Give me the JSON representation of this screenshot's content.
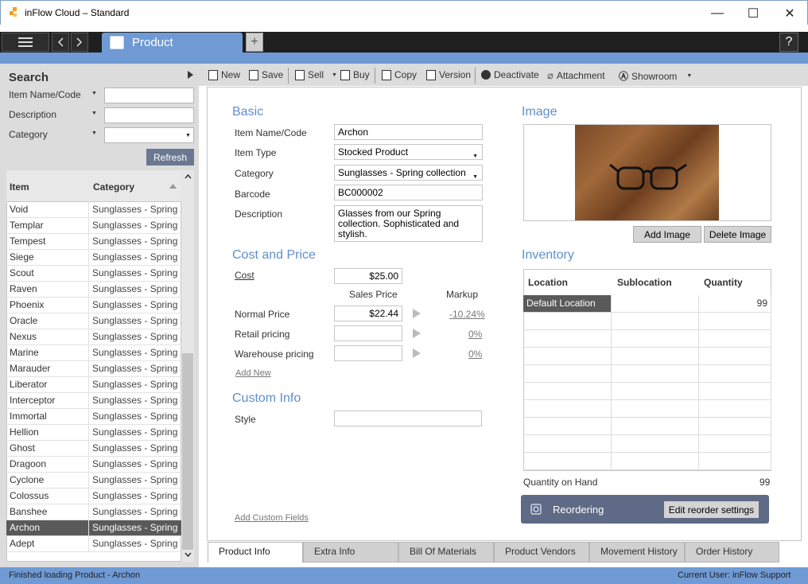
{
  "window": {
    "title": "inFlow Cloud – Standard",
    "minimize": "—",
    "maximize": "☐",
    "close": "✕"
  },
  "tabs": {
    "product_tab": "Product",
    "add_tab": "+",
    "help": "?"
  },
  "search": {
    "title": "Search",
    "item_label": "Item Name/Code",
    "description_label": "Description",
    "category_label": "Category",
    "refresh": "Refresh"
  },
  "grid": {
    "headers": {
      "item": "Item",
      "category": "Category"
    },
    "rows": [
      {
        "item": "Void",
        "category": "Sunglasses - Spring ..."
      },
      {
        "item": "Templar",
        "category": "Sunglasses - Spring ..."
      },
      {
        "item": "Tempest",
        "category": "Sunglasses - Spring ..."
      },
      {
        "item": "Siege",
        "category": "Sunglasses - Spring ..."
      },
      {
        "item": "Scout",
        "category": "Sunglasses - Spring ..."
      },
      {
        "item": "Raven",
        "category": "Sunglasses - Spring ..."
      },
      {
        "item": "Phoenix",
        "category": "Sunglasses - Spring ..."
      },
      {
        "item": "Oracle",
        "category": "Sunglasses - Spring ..."
      },
      {
        "item": "Nexus",
        "category": "Sunglasses - Spring ..."
      },
      {
        "item": "Marine",
        "category": "Sunglasses - Spring ..."
      },
      {
        "item": "Marauder",
        "category": "Sunglasses - Spring ..."
      },
      {
        "item": "Liberator",
        "category": "Sunglasses - Spring ..."
      },
      {
        "item": "Interceptor",
        "category": "Sunglasses - Spring ..."
      },
      {
        "item": "Immortal",
        "category": "Sunglasses - Spring ..."
      },
      {
        "item": "Hellion",
        "category": "Sunglasses - Spring ..."
      },
      {
        "item": "Ghost",
        "category": "Sunglasses - Spring ..."
      },
      {
        "item": "Dragoon",
        "category": "Sunglasses - Spring ..."
      },
      {
        "item": "Cyclone",
        "category": "Sunglasses - Spring ..."
      },
      {
        "item": "Colossus",
        "category": "Sunglasses - Spring ..."
      },
      {
        "item": "Banshee",
        "category": "Sunglasses - Spring ..."
      },
      {
        "item": "Archon",
        "category": "Sunglasses - Spring ..."
      },
      {
        "item": "Adept",
        "category": "Sunglasses - Spring ..."
      }
    ]
  },
  "toolbar": {
    "new": "New",
    "save": "Save",
    "sell": "Sell",
    "buy": "Buy",
    "copy": "Copy",
    "version": "Version",
    "deactivate": "Deactivate",
    "attachment": "Attachment",
    "showroom": "Showroom"
  },
  "basic": {
    "title": "Basic",
    "item_name_label": "Item Name/Code",
    "item_name": "Archon",
    "item_type_label": "Item Type",
    "item_type": "Stocked Product",
    "category_label": "Category",
    "category": "Sunglasses - Spring collection",
    "barcode_label": "Barcode",
    "barcode": "BC000002",
    "description_label": "Description",
    "description": "Glasses from our Spring collection. Sophisticated and stylish."
  },
  "cost_price": {
    "title": "Cost and Price",
    "cost_label": "Cost",
    "cost": "$25.00",
    "sales_price_header": "Sales Price",
    "markup_header": "Markup",
    "normal_label": "Normal Price",
    "normal_price": "$22.44",
    "normal_markup": "-10.24%",
    "retail_label": "Retail pricing",
    "retail_markup": "0%",
    "warehouse_label": "Warehouse pricing",
    "warehouse_markup": "0%",
    "add_new": "Add New"
  },
  "custom": {
    "title": "Custom Info",
    "style_label": "Style",
    "add_fields": "Add Custom Fields"
  },
  "image": {
    "title": "Image",
    "add": "Add Image",
    "delete": "Delete Image"
  },
  "inventory": {
    "title": "Inventory",
    "headers": {
      "location": "Location",
      "sublocation": "Sublocation",
      "quantity": "Quantity"
    },
    "rows": [
      {
        "location": "Default Location",
        "sublocation": "",
        "quantity": "99"
      }
    ],
    "qoh_label": "Quantity on Hand",
    "qoh": "99",
    "reordering": "Reordering",
    "edit_reorder": "Edit reorder settings"
  },
  "bottom_tabs": [
    "Product Info",
    "Extra Info",
    "Bill Of Materials",
    "Product Vendors",
    "Movement History",
    "Order History"
  ],
  "status": {
    "left": "Finished loading Product - Archon",
    "right": "Current User:  inFlow Support"
  },
  "colors": {
    "accent": "#6f9ad4",
    "section": "#5f8fcc",
    "selected_row": "#5a5a5a"
  }
}
